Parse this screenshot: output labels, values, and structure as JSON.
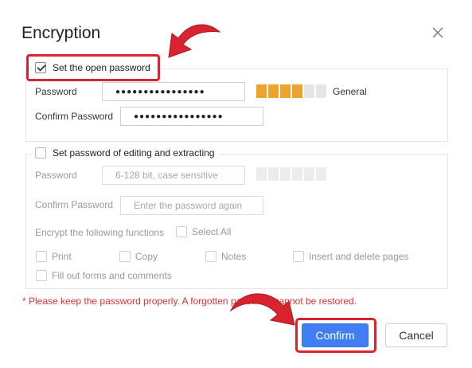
{
  "dialog": {
    "title": "Encryption",
    "close_icon": "close-icon"
  },
  "open_password": {
    "legend": "Set the open password",
    "checked": true,
    "password_label": "Password",
    "password_value": "●●●●●●●●●●●●●●●●",
    "confirm_label": "Confirm Password",
    "confirm_value": "●●●●●●●●●●●●●●●●",
    "strength_filled": 4,
    "strength_total": 6,
    "strength_label": "General"
  },
  "edit_password": {
    "legend": "Set password of editing and extracting",
    "checked": false,
    "password_label": "Password",
    "password_placeholder": "6-128 bit, case sensitive",
    "confirm_label": "Confirm Password",
    "confirm_placeholder": "Enter the password again",
    "functions_label": "Encrypt the following functions",
    "select_all": "Select All",
    "options": [
      "Print",
      "Copy",
      "Notes",
      "Insert and delete pages",
      "Fill out forms and comments"
    ]
  },
  "warning": "*  Please keep the password properly. A forgotten password cannot be restored.",
  "buttons": {
    "confirm": "Confirm",
    "cancel": "Cancel"
  },
  "colors": {
    "accent": "#3f7ff1",
    "highlight": "#d9232e",
    "strength": "#f0a32c",
    "warning": "#e03131"
  }
}
